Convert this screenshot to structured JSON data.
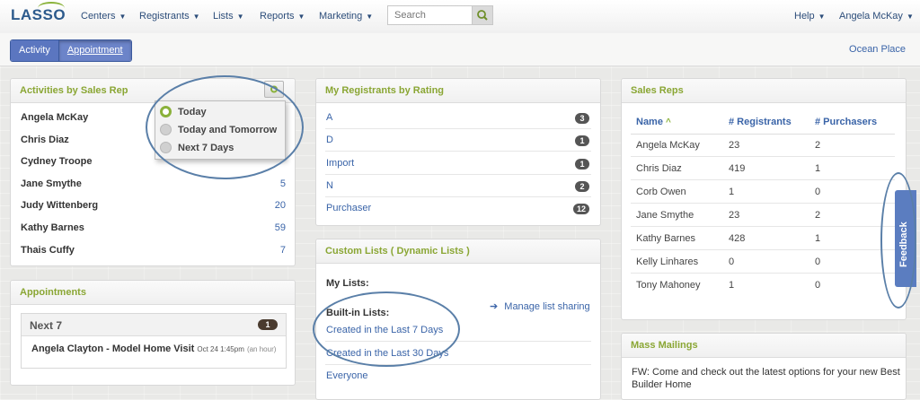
{
  "nav": {
    "logo": "LASSO",
    "items": [
      "Centers",
      "Registrants",
      "Lists",
      "Reports",
      "Marketing"
    ],
    "search_placeholder": "Search",
    "help": "Help",
    "user": "Angela McKay"
  },
  "subnav": {
    "buttons": [
      "Activity",
      "Appointment"
    ],
    "location": "Ocean Place"
  },
  "activities": {
    "title": "Activities by Sales Rep",
    "rows": [
      {
        "name": "Angela McKay",
        "count": ""
      },
      {
        "name": "Chris Diaz",
        "count": ""
      },
      {
        "name": "Cydney Troope",
        "count": ""
      },
      {
        "name": "Jane Smythe",
        "count": "5"
      },
      {
        "name": "Judy Wittenberg",
        "count": "20"
      },
      {
        "name": "Kathy Barnes",
        "count": "59"
      },
      {
        "name": "Thais Cuffy",
        "count": "7"
      }
    ],
    "dropdown": [
      "Today",
      "Today and Tomorrow",
      "Next 7 Days"
    ]
  },
  "appointments": {
    "title": "Appointments",
    "group": "Next 7",
    "group_count": "1",
    "item_title": "Angela Clayton - Model Home Visit",
    "item_date": "Oct 24 1:45pm",
    "item_duration": "(an hour)"
  },
  "ratings": {
    "title": "My Registrants by Rating",
    "rows": [
      {
        "label": "A",
        "count": "3"
      },
      {
        "label": "D",
        "count": "1"
      },
      {
        "label": "Import",
        "count": "1"
      },
      {
        "label": "N",
        "count": "2"
      },
      {
        "label": "Purchaser",
        "count": "12"
      }
    ]
  },
  "custom_lists": {
    "title": "Custom Lists ( Dynamic Lists )",
    "my_lists": "My Lists:",
    "manage": "Manage list sharing",
    "built_in": "Built-in Lists:",
    "items": [
      "Created in the Last 7 Days",
      "Created in the Last 30 Days",
      "Everyone"
    ]
  },
  "sales_reps": {
    "title": "Sales Reps",
    "headers": [
      "Name",
      "# Registrants",
      "# Purchasers"
    ],
    "rows": [
      [
        "Angela McKay",
        "23",
        "2"
      ],
      [
        "Chris Diaz",
        "419",
        "1"
      ],
      [
        "Corb Owen",
        "1",
        "0"
      ],
      [
        "Jane Smythe",
        "23",
        "2"
      ],
      [
        "Kathy Barnes",
        "428",
        "1"
      ],
      [
        "Kelly Linhares",
        "0",
        "0"
      ],
      [
        "Tony Mahoney",
        "1",
        "0"
      ]
    ]
  },
  "mass_mailings": {
    "title": "Mass Mailings",
    "line1": "FW: Come and check out the latest options for your new Best",
    "line2": "Builder Home"
  },
  "feedback": "Feedback",
  "colors": {
    "accent_green": "#8aa634",
    "link_blue": "#3a64a8",
    "button_blue": "#5b76c0"
  }
}
